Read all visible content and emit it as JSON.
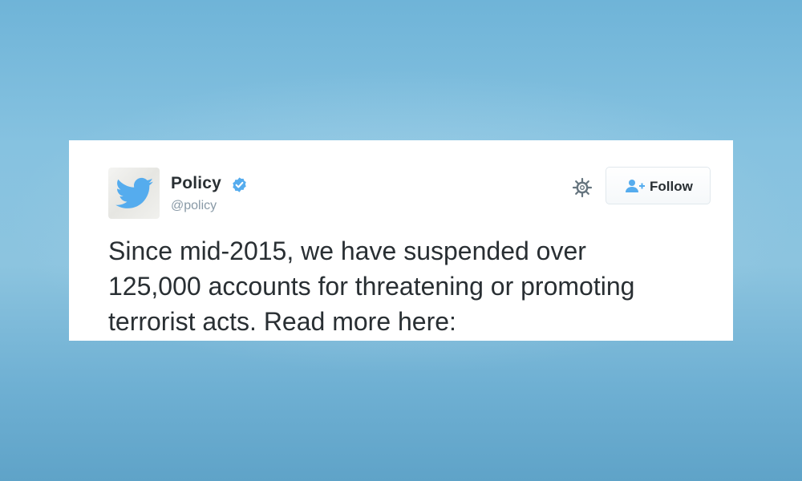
{
  "tweet": {
    "author": {
      "display_name": "Policy",
      "handle": "@policy",
      "verified": true,
      "avatar_icon": "twitter-bird-icon"
    },
    "follow_label": "Follow",
    "lines": [
      "Since mid-2015, we have suspended over",
      "125,000 accounts for threatening or promoting",
      "terrorist acts. Read more here:"
    ]
  },
  "colors": {
    "brand_blue": "#55acee",
    "text_dark": "#292f33",
    "text_muted": "#8899a6",
    "background_blue": "#7cbcdd"
  }
}
